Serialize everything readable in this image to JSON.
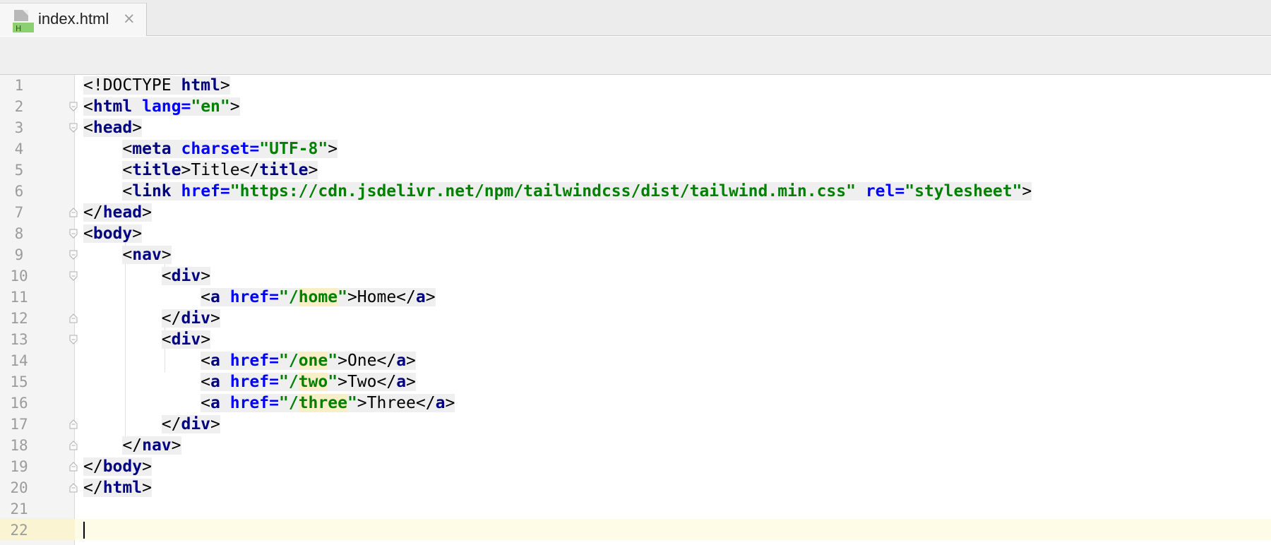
{
  "tab": {
    "label": "index.html",
    "close": "×",
    "icon": "html-file-icon"
  },
  "code": {
    "line_numbers": [
      "1",
      "2",
      "3",
      "4",
      "5",
      "6",
      "7",
      "8",
      "9",
      "10",
      "11",
      "12",
      "13",
      "14",
      "15",
      "16",
      "17",
      "18",
      "19",
      "20",
      "21",
      "22"
    ],
    "lines": [
      [
        [
          "p",
          "<!DOCTYPE "
        ],
        [
          "t",
          "html"
        ],
        [
          "p",
          ">"
        ]
      ],
      [
        [
          "p",
          "<"
        ],
        [
          "t",
          "html "
        ],
        [
          "a",
          "lang="
        ],
        [
          "v",
          "\"en\""
        ],
        [
          "p",
          ">"
        ]
      ],
      [
        [
          "p",
          "<"
        ],
        [
          "t",
          "head"
        ],
        [
          "p",
          ">"
        ]
      ],
      [
        [
          "p",
          "    <"
        ],
        [
          "t",
          "meta "
        ],
        [
          "a",
          "charset="
        ],
        [
          "v",
          "\"UTF-8\""
        ],
        [
          "p",
          ">"
        ]
      ],
      [
        [
          "p",
          "    <"
        ],
        [
          "t",
          "title"
        ],
        [
          "p",
          ">Title</"
        ],
        [
          "t",
          "title"
        ],
        [
          "p",
          ">"
        ]
      ],
      [
        [
          "p",
          "    <"
        ],
        [
          "t",
          "link "
        ],
        [
          "a",
          "href="
        ],
        [
          "v",
          "\"https://cdn.jsdelivr.net/npm/tailwindcss/dist/tailwind.min.css\" "
        ],
        [
          "a",
          "rel="
        ],
        [
          "v",
          "\"stylesheet\""
        ],
        [
          "p",
          ">"
        ]
      ],
      [
        [
          "p",
          "</"
        ],
        [
          "t",
          "head"
        ],
        [
          "p",
          ">"
        ]
      ],
      [
        [
          "p",
          "<"
        ],
        [
          "t",
          "body"
        ],
        [
          "p",
          ">"
        ]
      ],
      [
        [
          "p",
          "    <"
        ],
        [
          "t",
          "nav"
        ],
        [
          "p",
          ">"
        ]
      ],
      [
        [
          "p",
          "        <"
        ],
        [
          "t",
          "div"
        ],
        [
          "p",
          ">"
        ]
      ],
      [
        [
          "p",
          "            <"
        ],
        [
          "t",
          "a "
        ],
        [
          "a",
          "href="
        ],
        [
          "v",
          "\"/"
        ],
        [
          "vh",
          "home"
        ],
        [
          "v",
          "\""
        ],
        [
          "p",
          ">Home</"
        ],
        [
          "t",
          "a"
        ],
        [
          "p",
          ">"
        ]
      ],
      [
        [
          "p",
          "        </"
        ],
        [
          "t",
          "div"
        ],
        [
          "p",
          ">"
        ]
      ],
      [
        [
          "p",
          "        <"
        ],
        [
          "t",
          "div"
        ],
        [
          "p",
          ">"
        ]
      ],
      [
        [
          "p",
          "            <"
        ],
        [
          "t",
          "a "
        ],
        [
          "a",
          "href="
        ],
        [
          "v",
          "\"/"
        ],
        [
          "vh",
          "one"
        ],
        [
          "v",
          "\""
        ],
        [
          "p",
          ">One</"
        ],
        [
          "t",
          "a"
        ],
        [
          "p",
          ">"
        ]
      ],
      [
        [
          "p",
          "            <"
        ],
        [
          "t",
          "a "
        ],
        [
          "a",
          "href="
        ],
        [
          "v",
          "\"/"
        ],
        [
          "vh",
          "two"
        ],
        [
          "v",
          "\""
        ],
        [
          "p",
          ">Two</"
        ],
        [
          "t",
          "a"
        ],
        [
          "p",
          ">"
        ]
      ],
      [
        [
          "p",
          "            <"
        ],
        [
          "t",
          "a "
        ],
        [
          "a",
          "href="
        ],
        [
          "v",
          "\"/"
        ],
        [
          "vh",
          "three"
        ],
        [
          "v",
          "\""
        ],
        [
          "p",
          ">Three</"
        ],
        [
          "t",
          "a"
        ],
        [
          "p",
          ">"
        ]
      ],
      [
        [
          "p",
          "        </"
        ],
        [
          "t",
          "div"
        ],
        [
          "p",
          ">"
        ]
      ],
      [
        [
          "p",
          "    </"
        ],
        [
          "t",
          "nav"
        ],
        [
          "p",
          ">"
        ]
      ],
      [
        [
          "p",
          "</"
        ],
        [
          "t",
          "body"
        ],
        [
          "p",
          ">"
        ]
      ],
      [
        [
          "p",
          "</"
        ],
        [
          "t",
          "html"
        ],
        [
          "p",
          ">"
        ]
      ],
      [],
      []
    ],
    "fold_markers": {
      "2": "open",
      "3": "open",
      "7": "close",
      "8": "open",
      "9": "open",
      "10": "open",
      "12": "close",
      "13": "open",
      "17": "close",
      "18": "close",
      "19": "close",
      "20": "close"
    },
    "current_line": "22"
  }
}
